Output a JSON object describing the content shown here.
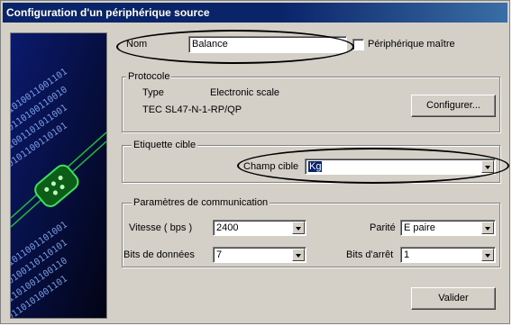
{
  "window": {
    "title": "Configuration d'un périphérique source"
  },
  "name_row": {
    "label": "Nom",
    "value": "Balance",
    "master_label": "Périphérique maître",
    "master_checked": false
  },
  "protocole": {
    "legend": "Protocole",
    "type_label": "Type",
    "type_value": "Electronic scale",
    "model": "TEC SL47-N-1-RP/QP",
    "configure_label": "Configurer..."
  },
  "etiquette": {
    "legend": "Etiquette cible",
    "field_label": "Champ cible",
    "field_value": "Kg"
  },
  "communication": {
    "legend": "Paramètres de communication",
    "speed_label": "Vitesse ( bps )",
    "speed_value": "2400",
    "parity_label": "Parité",
    "parity_value": "E paire",
    "databits_label": "Bits de données",
    "databits_value": "7",
    "stopbits_label": "Bits d'arrêt",
    "stopbits_value": "1"
  },
  "actions": {
    "validate_label": "Valider"
  },
  "colors": {
    "title_bar": "#0a246a",
    "window_bg": "#d4d0c8",
    "annotation": "#000000"
  },
  "icons": {
    "side_image": "serial-connector-binary-illustration"
  }
}
